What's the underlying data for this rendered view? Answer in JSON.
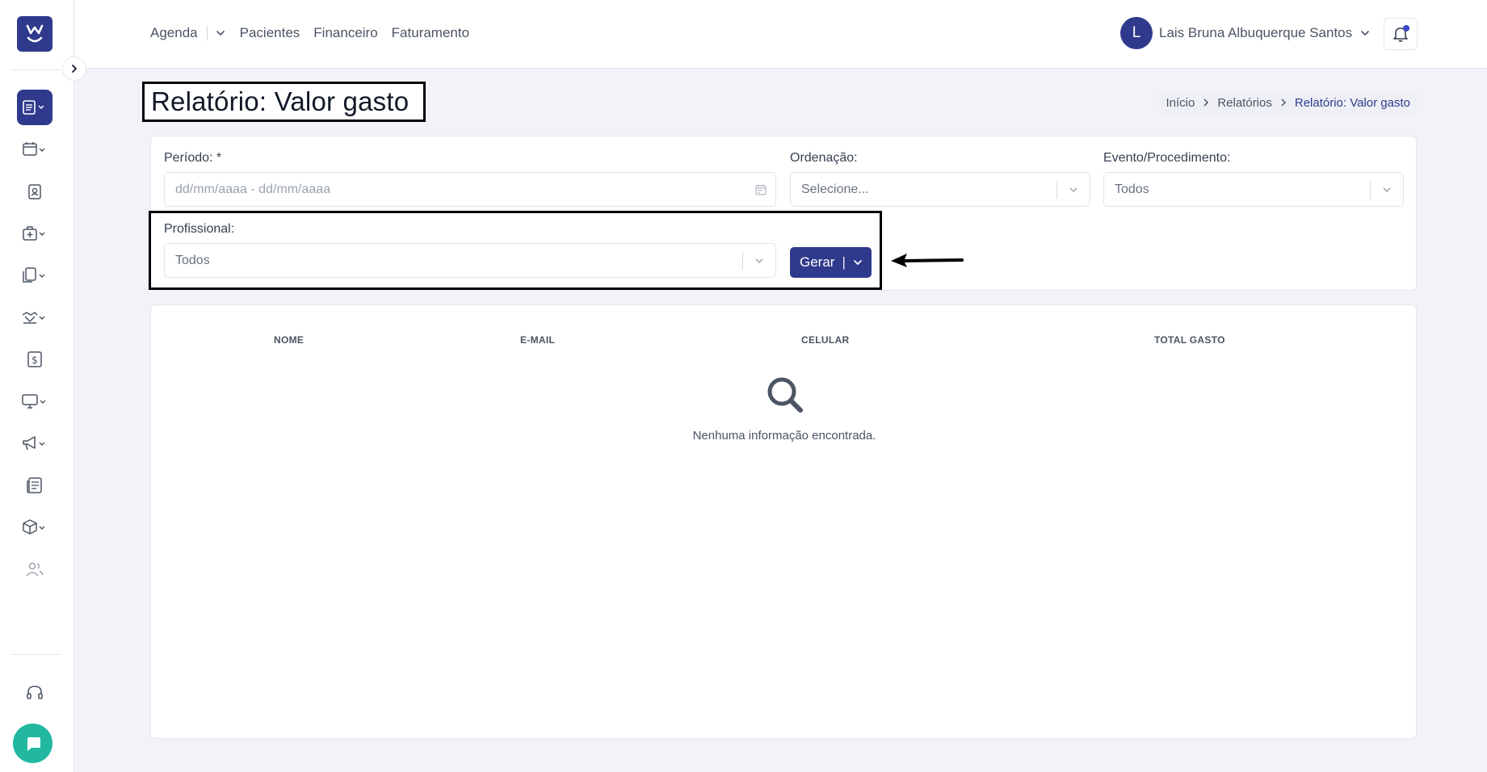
{
  "nav": {
    "items": [
      {
        "label": "Agenda"
      },
      {
        "label": "Pacientes"
      },
      {
        "label": "Financeiro"
      },
      {
        "label": "Faturamento"
      }
    ]
  },
  "user": {
    "initial": "L",
    "name": "Lais Bruna Albuquerque Santos"
  },
  "page": {
    "title": "Relatório: Valor gasto"
  },
  "breadcrumb": {
    "items": [
      "Início",
      "Relatórios",
      "Relatório: Valor gasto"
    ]
  },
  "filters": {
    "periodo": {
      "label": "Período: *",
      "placeholder": "dd/mm/aaaa - dd/mm/aaaa"
    },
    "ordenacao": {
      "label": "Ordenação:",
      "value": "Selecione..."
    },
    "evento": {
      "label": "Evento/Procedimento:",
      "value": "Todos"
    },
    "profissional": {
      "label": "Profissional:",
      "value": "Todos"
    },
    "gerar_label": "Gerar",
    "gerar_sep": "|"
  },
  "table": {
    "columns": [
      "NOME",
      "E-MAIL",
      "CELULAR",
      "TOTAL GASTO"
    ],
    "empty_message": "Nenhuma informação encontrada."
  },
  "colors": {
    "primary": "#2f3a8c",
    "chat": "#22b8a0",
    "annotation": "#000000"
  }
}
